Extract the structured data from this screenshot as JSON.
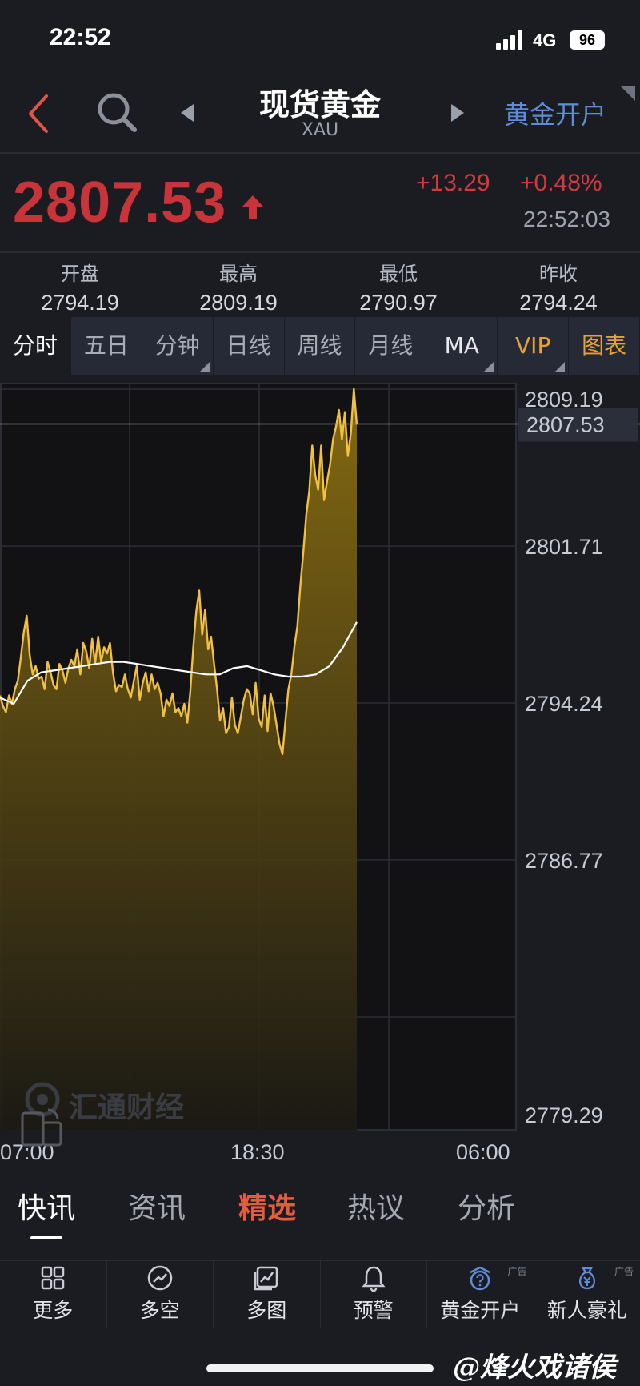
{
  "status_bar": {
    "time": "22:52",
    "network": "4G",
    "battery": "96"
  },
  "header": {
    "title": "现货黄金",
    "subtitle": "XAU",
    "open_account": "黄金开户"
  },
  "quote": {
    "price": "2807.53",
    "change": "+13.29",
    "change_pct": "+0.48%",
    "time": "22:52:03",
    "color_up": "#c8343a"
  },
  "stats": [
    {
      "label": "开盘",
      "value": "2794.19"
    },
    {
      "label": "最高",
      "value": "2809.19"
    },
    {
      "label": "最低",
      "value": "2790.97"
    },
    {
      "label": "昨收",
      "value": "2794.24"
    }
  ],
  "tabs": [
    "分时",
    "五日",
    "分钟",
    "日线",
    "周线",
    "月线",
    "MA",
    "VIP",
    "图表"
  ],
  "chart_data": {
    "type": "area",
    "y_tick_labels": [
      "2809.19",
      "2801.71",
      "2794.24",
      "2786.77",
      "2779.29"
    ],
    "current_price_label": "2807.53",
    "x_tick_labels": [
      "07:00",
      "18:30",
      "06:00"
    ],
    "ylim": [
      2779.29,
      2809.19
    ],
    "series": [
      {
        "values": [
          2794.6,
          2794.1,
          2793.8,
          2794.6,
          2794.2,
          2794.9,
          2795.3,
          2796.4,
          2797.6,
          2798.4,
          2796.5,
          2795.6,
          2796.0,
          2795.4,
          2795.5,
          2794.9,
          2796.2,
          2795.7,
          2795.1,
          2794.9,
          2796.1,
          2795.8,
          2795.2,
          2795.9,
          2796.3,
          2796.0,
          2796.8,
          2795.6,
          2797.1,
          2796.7,
          2795.9,
          2797.3,
          2796.1,
          2797.4,
          2796.2,
          2796.9,
          2796.6,
          2797.1,
          2795.7,
          2794.8,
          2795.1,
          2795.0,
          2795.6,
          2794.9,
          2794.5,
          2795.3,
          2796.0,
          2794.4,
          2795.2,
          2795.7,
          2794.8,
          2795.6,
          2794.9,
          2795.2,
          2794.7,
          2793.6,
          2794.4,
          2794.1,
          2794.7,
          2793.8,
          2794.0,
          2793.6,
          2794.2,
          2793.3,
          2794.8,
          2796.9,
          2798.6,
          2799.6,
          2797.5,
          2798.7,
          2796.8,
          2797.4,
          2796.1,
          2794.9,
          2793.4,
          2794.0,
          2792.8,
          2793.1,
          2794.5,
          2793.2,
          2792.8,
          2793.6,
          2794.4,
          2794.9,
          2794.7,
          2793.7,
          2795.2,
          2793.5,
          2793.1,
          2794.6,
          2792.9,
          2794.7,
          2794.1,
          2793.2,
          2792.3,
          2791.8,
          2793.4,
          2794.9,
          2795.6,
          2796.9,
          2797.9,
          2799.8,
          2801.4,
          2803.2,
          2804.3,
          2806.5,
          2805.1,
          2804.4,
          2806.5,
          2803.9,
          2804.8,
          2805.6,
          2806.8,
          2807.4,
          2808.2,
          2806.8,
          2808.1,
          2806.0,
          2807.1,
          2809.2,
          2807.5
        ],
        "ma_values": [
          2794.5,
          2794.2,
          2795.3,
          2795.7,
          2795.8,
          2795.9,
          2796.0,
          2796.1,
          2796.2,
          2796.2,
          2796.1,
          2796.0,
          2795.9,
          2795.8,
          2795.7,
          2795.6,
          2795.6,
          2795.9,
          2796.0,
          2795.8,
          2795.6,
          2795.5,
          2795.5,
          2795.6,
          2796.0,
          2796.9,
          2798.1
        ]
      }
    ],
    "colors": {
      "line": "#f1c040",
      "ma": "#ffffff",
      "area_top": "#8a6e12",
      "area_bottom": "#1c1a14"
    }
  },
  "news_tabs": [
    "快讯",
    "资讯",
    "精选",
    "热议",
    "分析"
  ],
  "toolbar": [
    {
      "label": "更多",
      "icon": "grid-icon",
      "ad": ""
    },
    {
      "label": "多空",
      "icon": "trend-gauge-icon",
      "ad": ""
    },
    {
      "label": "多图",
      "icon": "multi-chart-icon",
      "ad": ""
    },
    {
      "label": "预警",
      "icon": "bell-icon",
      "ad": ""
    },
    {
      "label": "黄金开户",
      "icon": "question-badge-icon",
      "ad": "广告"
    },
    {
      "label": "新人豪礼",
      "icon": "money-bag-icon",
      "ad": "广告"
    }
  ],
  "watermark": "汇通财经",
  "signature": "@烽火戏诸侯"
}
